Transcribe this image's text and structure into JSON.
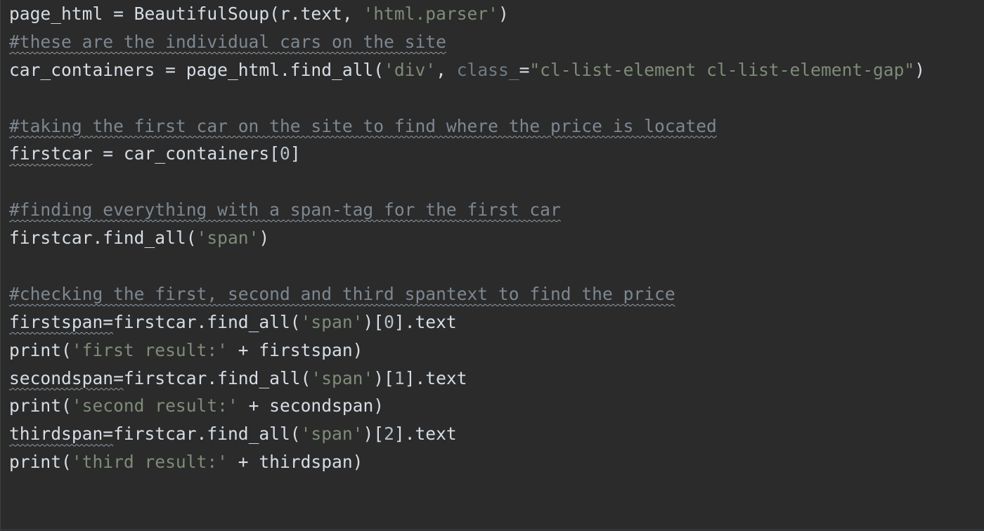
{
  "editor": {
    "lines": [
      [
        {
          "text": "page_html = BeautifulSoup(r.text, ",
          "style": "code"
        },
        {
          "text": "'html.parser'",
          "style": "str"
        },
        {
          "text": ")",
          "style": "code"
        }
      ],
      [
        {
          "text": "#these are the individual cars on the site",
          "style": "cm",
          "squiggle": true
        }
      ],
      [
        {
          "text": "car_containers = page_html.find_all(",
          "style": "code"
        },
        {
          "text": "'div'",
          "style": "str"
        },
        {
          "text": ", ",
          "style": "code"
        },
        {
          "text": "class_",
          "style": "kw"
        },
        {
          "text": "=",
          "style": "code"
        },
        {
          "text": "\"cl-list-element cl-list-element-gap\"",
          "style": "str"
        },
        {
          "text": ")",
          "style": "code"
        }
      ],
      [],
      [
        {
          "text": "#taking the first car on the site to find where the price is located",
          "style": "cm",
          "squiggle": true
        }
      ],
      [
        {
          "text": "firstcar",
          "style": "code",
          "squiggle": true
        },
        {
          "text": " = car_containers[",
          "style": "code"
        },
        {
          "text": "0",
          "style": "ln"
        },
        {
          "text": "]",
          "style": "code"
        }
      ],
      [],
      [
        {
          "text": "#finding everything with a span-tag for the first car",
          "style": "cm",
          "squiggle": true
        }
      ],
      [
        {
          "text": "firstcar.find_all(",
          "style": "code"
        },
        {
          "text": "'span'",
          "style": "str"
        },
        {
          "text": ")",
          "style": "code"
        }
      ],
      [],
      [
        {
          "text": "#checking the first, second and third spantext to find the price",
          "style": "cm",
          "squiggle": true
        }
      ],
      [
        {
          "text": "firstspan=",
          "style": "code",
          "squiggle": true
        },
        {
          "text": "firstcar.find_all(",
          "style": "code"
        },
        {
          "text": "'span'",
          "style": "str"
        },
        {
          "text": ")[",
          "style": "code"
        },
        {
          "text": "0",
          "style": "ln"
        },
        {
          "text": "].text",
          "style": "code"
        }
      ],
      [
        {
          "text": "print(",
          "style": "code"
        },
        {
          "text": "'first result:'",
          "style": "str"
        },
        {
          "text": " + firstspan)",
          "style": "code"
        }
      ],
      [
        {
          "text": "secondspan=",
          "style": "code",
          "squiggle": true
        },
        {
          "text": "firstcar.find_all(",
          "style": "code"
        },
        {
          "text": "'span'",
          "style": "str"
        },
        {
          "text": ")[",
          "style": "code"
        },
        {
          "text": "1",
          "style": "ln"
        },
        {
          "text": "].text",
          "style": "code"
        }
      ],
      [
        {
          "text": "print(",
          "style": "code"
        },
        {
          "text": "'second result:'",
          "style": "str"
        },
        {
          "text": " + secondspan)",
          "style": "code"
        }
      ],
      [
        {
          "text": "thirdspan=",
          "style": "code",
          "squiggle": true
        },
        {
          "text": "firstcar.find_all(",
          "style": "code"
        },
        {
          "text": "'span'",
          "style": "str"
        },
        {
          "text": ")[",
          "style": "code"
        },
        {
          "text": "2",
          "style": "ln"
        },
        {
          "text": "].text",
          "style": "code"
        }
      ],
      [
        {
          "text": "print(",
          "style": "code"
        },
        {
          "text": "'third result:'",
          "style": "str"
        },
        {
          "text": " + thirdspan)",
          "style": "code"
        }
      ]
    ]
  },
  "colors": {
    "background": "#2b2b2b",
    "code": "#d6dde5",
    "string": "#7e8c78",
    "keyword_arg": "#6f7b86",
    "comment": "#7d8791",
    "number": "#b5bfc8"
  }
}
